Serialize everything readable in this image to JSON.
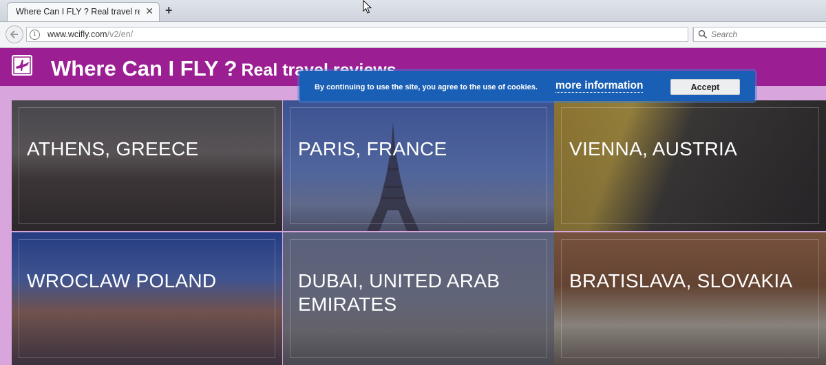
{
  "browser": {
    "tab_title": "Where Can I FLY ? Real travel re...",
    "new_tab_label": "+",
    "url_domain": "www.wcifly.com",
    "url_path": "/v2/en/",
    "search_placeholder": "Search"
  },
  "site": {
    "title": "Where Can I FLY ?",
    "subtitle": "Real travel reviews"
  },
  "cookie": {
    "text": "By continuing to use the site, you agree to the use of cookies.",
    "link": "more information",
    "accept": "Accept"
  },
  "destinations": [
    {
      "label": "ATHENS, GREECE"
    },
    {
      "label": "PARIS, FRANCE"
    },
    {
      "label": "VIENNA, AUSTRIA"
    },
    {
      "label": "WROCLAW POLAND"
    },
    {
      "label": "DUBAI, UNITED ARAB EMIRATES"
    },
    {
      "label": "BRATISLAVA, SLOVAKIA"
    }
  ],
  "colors": {
    "header": "#9b1e93",
    "page_bg": "#d8a6dc",
    "cookie_bar": "#1a5fb6"
  },
  "icons": [
    "close-icon",
    "plus-icon",
    "cursor-icon",
    "back-arrow-icon",
    "info-icon",
    "reload-icon",
    "search-icon",
    "airplane-logo-icon"
  ]
}
